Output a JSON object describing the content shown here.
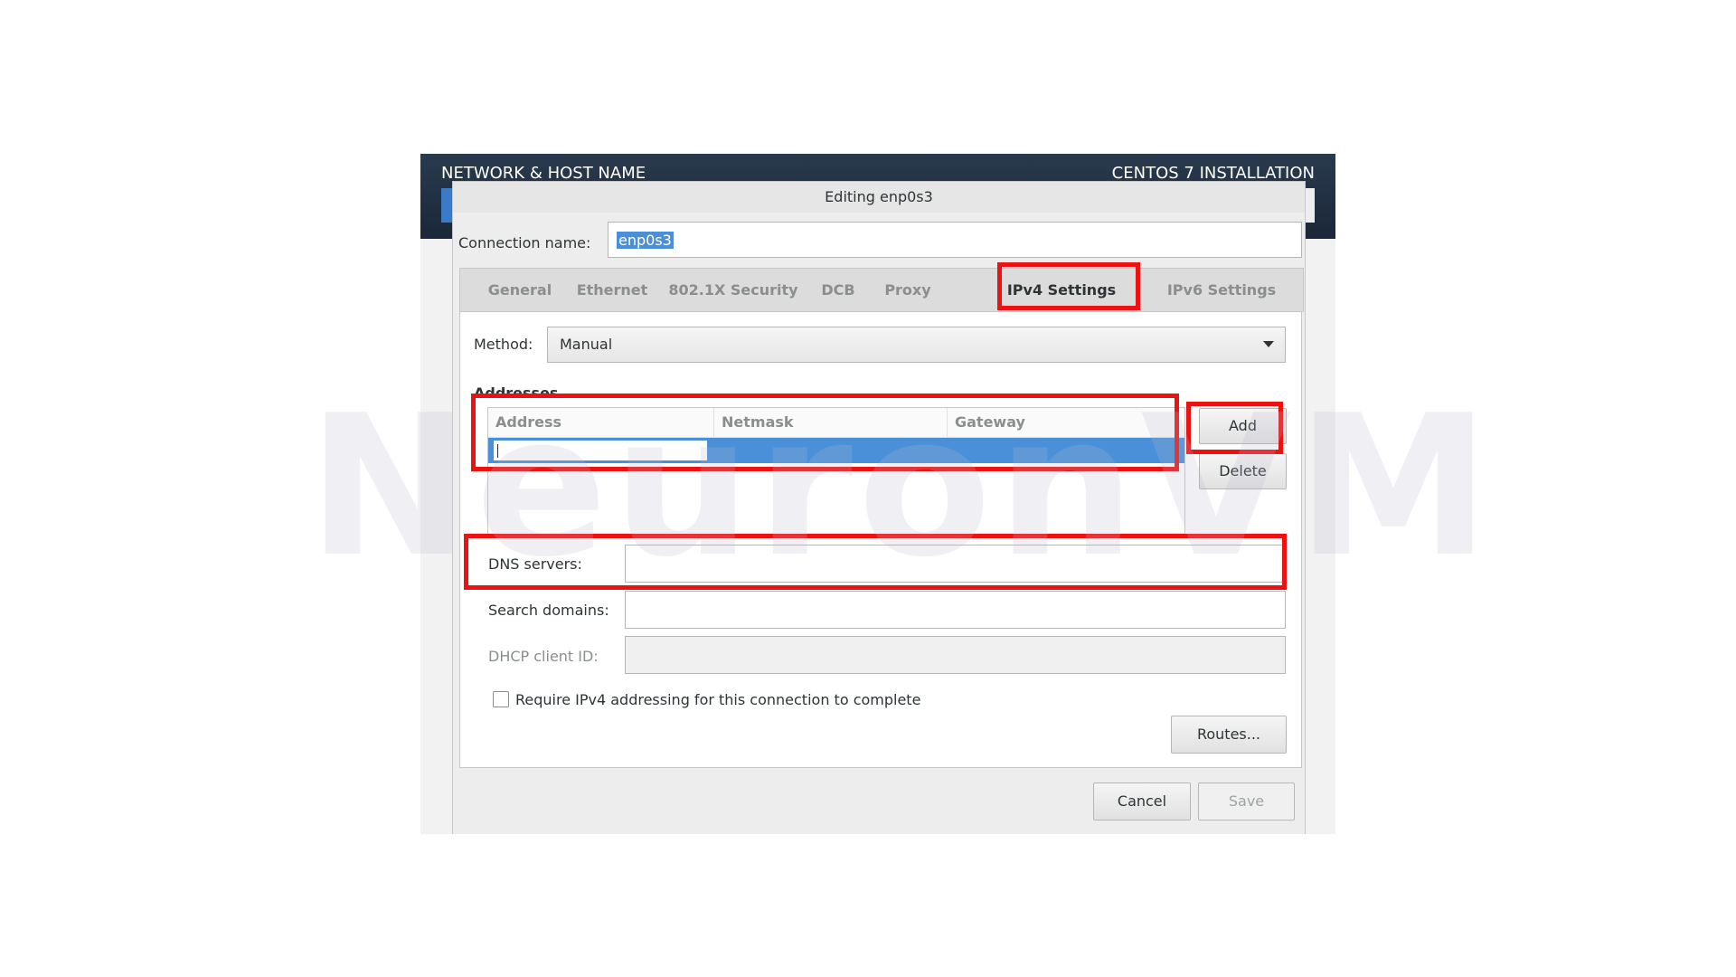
{
  "installer": {
    "title": "NETWORK & HOST NAME",
    "product": "CENTOS 7 INSTALLATION"
  },
  "watermark": "NeuronVM",
  "dialog": {
    "title": "Editing enp0s3",
    "connection_name_label": "Connection name:",
    "connection_name_value": "enp0s3",
    "tabs": [
      {
        "label": "General",
        "active": false
      },
      {
        "label": "Ethernet",
        "active": false
      },
      {
        "label": "802.1X Security",
        "active": false
      },
      {
        "label": "DCB",
        "active": false
      },
      {
        "label": "Proxy",
        "active": false
      },
      {
        "label": "IPv4 Settings",
        "active": true
      },
      {
        "label": "IPv6 Settings",
        "active": false
      }
    ],
    "method_label": "Method:",
    "method_value": "Manual",
    "addresses_label": "Addresses",
    "columns": [
      "Address",
      "Netmask",
      "Gateway"
    ],
    "add_button": "Add",
    "delete_button": "Delete",
    "dns_label": "DNS servers:",
    "dns_value": "",
    "search_label": "Search domains:",
    "search_value": "",
    "dhcp_label": "DHCP client ID:",
    "dhcp_value": "",
    "require_ipv4_label": "Require IPv4 addressing for this connection to complete",
    "require_ipv4_checked": false,
    "routes_button": "Routes...",
    "cancel_button": "Cancel",
    "save_button": "Save"
  },
  "colors": {
    "highlight": "#ee1111",
    "selection": "#4a90d9",
    "header": "#1a2738"
  }
}
